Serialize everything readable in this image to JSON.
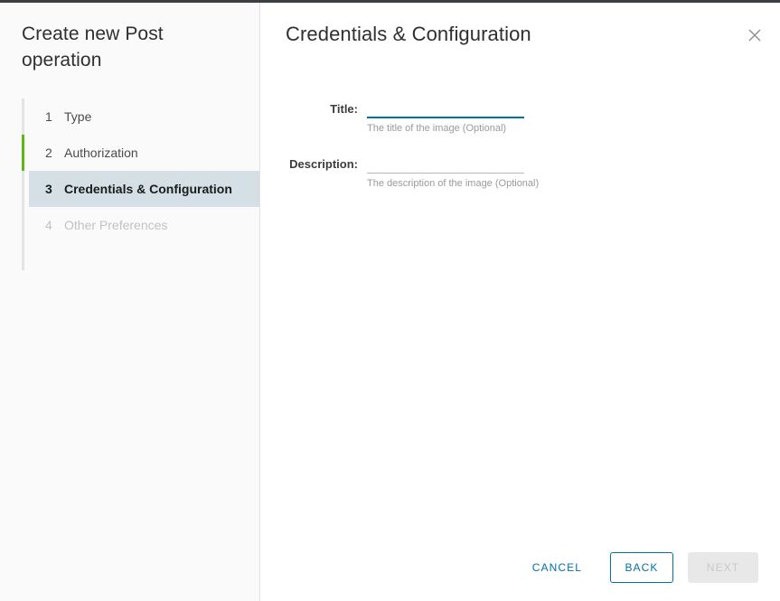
{
  "wizard": {
    "title": "Create new Post operation",
    "steps": [
      {
        "number": "1",
        "label": "Type",
        "state": "complete"
      },
      {
        "number": "2",
        "label": "Authorization",
        "state": "complete-active-marker"
      },
      {
        "number": "3",
        "label": "Credentials & Configuration",
        "state": "current"
      },
      {
        "number": "4",
        "label": "Other Preferences",
        "state": "disabled"
      }
    ]
  },
  "main": {
    "heading": "Credentials & Configuration",
    "close_icon": "close-icon",
    "fields": [
      {
        "label": "Title:",
        "value": "",
        "placeholder": "",
        "help": "The title of the image (Optional)",
        "focused": true
      },
      {
        "label": "Description:",
        "value": "",
        "placeholder": "",
        "help": "The description of the image (Optional)",
        "focused": false
      }
    ]
  },
  "footer": {
    "cancel_label": "CANCEL",
    "back_label": "BACK",
    "next_label": "NEXT"
  },
  "colors": {
    "accent_blue": "#0072a3",
    "active_green": "#5eb715",
    "current_step_bg": "#d4dfe6",
    "sidebar_bg": "#fafafa",
    "disabled_bg": "#e8e8e8",
    "top_border": "#3b3f42"
  }
}
